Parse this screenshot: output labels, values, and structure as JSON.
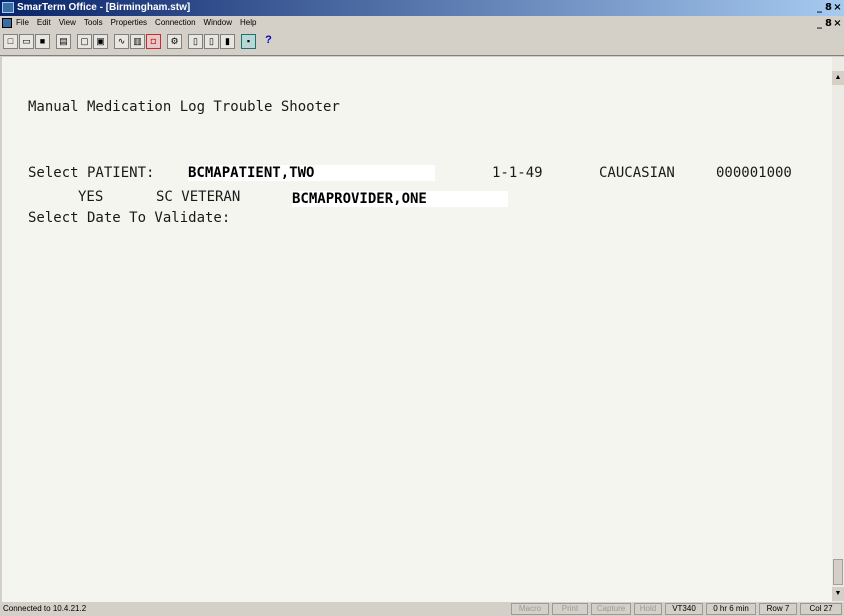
{
  "window": {
    "title": "SmarTerm Office - [Birmingham.stw]",
    "controls": [
      "_",
      "8",
      "×"
    ]
  },
  "menu": {
    "items": [
      "File",
      "Edit",
      "View",
      "Tools",
      "Properties",
      "Connection",
      "Window",
      "Help"
    ]
  },
  "toolbar": {
    "help_label": "?"
  },
  "terminal": {
    "heading": "Manual Medication Log Trouble Shooter",
    "select_patient_prompt": "Select PATIENT: ",
    "patient_name": "BCMAPATIENT,TWO",
    "dob": "1-1-49",
    "race": "CAUCASIAN",
    "patient_id": "000001000",
    "veteran_flag": "YES",
    "veteran_status": "SC VETERAN",
    "provider": "BCMAPROVIDER,ONE",
    "date_prompt": "Select Date To Validate:"
  },
  "status": {
    "connection": "Connected to 10.4.21.2",
    "macro": "Macro",
    "print": "Print",
    "capture": "Capture",
    "hold": "Hold",
    "emulation": "VT340",
    "session_time": "0 hr 6 min",
    "row": "Row 7",
    "col": "Col 27"
  }
}
